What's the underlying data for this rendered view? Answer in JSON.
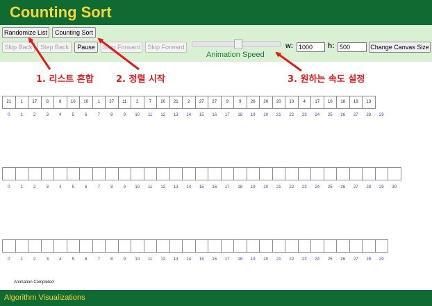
{
  "header": {
    "title": "Counting Sort"
  },
  "toolbar": {
    "randomize": "Randomize List",
    "counting_sort": "Counting Sort",
    "skip_back": "Skip Back",
    "step_back": "Step Back",
    "pause": "Pause",
    "step_forward": "Step Forward",
    "skip_forward": "Skip Forward",
    "speed_label": "Animation Speed",
    "speed_level": 0.5,
    "w_label": "w:",
    "w_value": "1000",
    "h_label": "h:",
    "h_value": "500",
    "change_canvas": "Change Canvas Size"
  },
  "annotations": {
    "a1": "1. 리스트 혼합",
    "a2": "2. 정렬 시작",
    "a3": "3. 원하는 속도 설정"
  },
  "arrays": {
    "input": {
      "values": [
        "21",
        "1",
        "17",
        "8",
        "8",
        "10",
        "10",
        "1",
        "27",
        "11",
        "2",
        "7",
        "20",
        "21",
        "2",
        "27",
        "27",
        "9",
        "9",
        "26",
        "20",
        "20",
        "10",
        "4",
        "17",
        "10",
        "18",
        "18",
        "13"
      ],
      "indices": [
        "0",
        "1",
        "2",
        "3",
        "4",
        "5",
        "6",
        "7",
        "8",
        "9",
        "10",
        "11",
        "12",
        "13",
        "14",
        "15",
        "16",
        "17",
        "18",
        "19",
        "20",
        "21",
        "22",
        "23",
        "24",
        "25",
        "26",
        "27",
        "28",
        "29"
      ]
    },
    "count": {
      "indices": [
        "0",
        "1",
        "2",
        "3",
        "4",
        "5",
        "6",
        "7",
        "8",
        "9",
        "10",
        "11",
        "12",
        "13",
        "14",
        "15",
        "16",
        "17",
        "18",
        "19",
        "20",
        "21",
        "22",
        "23",
        "24",
        "25",
        "26",
        "27",
        "28",
        "29",
        "30"
      ]
    },
    "output": {
      "indices": [
        "0",
        "1",
        "2",
        "3",
        "4",
        "5",
        "6",
        "7",
        "8",
        "9",
        "10",
        "11",
        "12",
        "13",
        "14",
        "15",
        "16",
        "17",
        "18",
        "19",
        "20",
        "21",
        "22",
        "23",
        "24",
        "25",
        "26",
        "27",
        "28",
        "29"
      ]
    }
  },
  "status": "Animation Completed",
  "footer": {
    "title": "Algorithm Visualizations"
  },
  "colors": {
    "header_bg": "#0f6b32",
    "title": "#f5d73a",
    "controls_bg": "#d9f0d3",
    "annotation": "#e01b1b",
    "index": "#3a3ad4"
  }
}
